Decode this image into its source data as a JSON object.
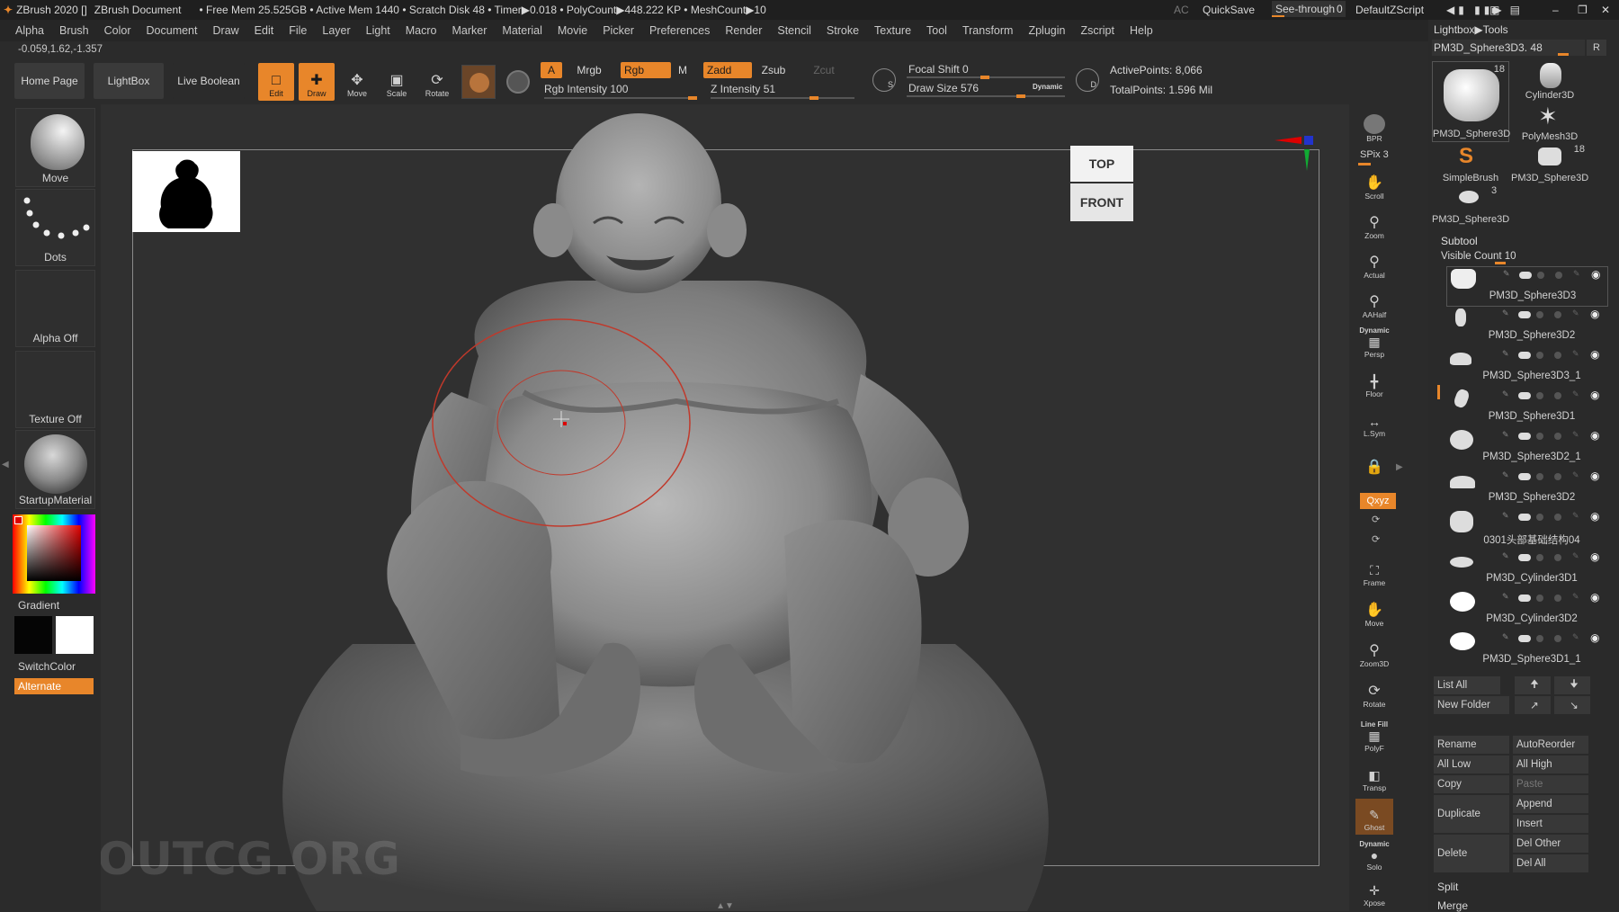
{
  "titlebar": {
    "app": "ZBrush 2020 []",
    "document": "ZBrush Document",
    "stats": "• Free Mem 25.525GB • Active Mem 1440 • Scratch Disk 48 • Timer▶0.018 • PolyCount▶448.222 KP • MeshCount▶10",
    "ac": "AC",
    "quicksave": "QuickSave",
    "see_through": "See-through",
    "see_through_value": "0",
    "default_zscript": "DefaultZScript"
  },
  "menu": [
    "Alpha",
    "Brush",
    "Color",
    "Document",
    "Draw",
    "Edit",
    "File",
    "Layer",
    "Light",
    "Macro",
    "Marker",
    "Material",
    "Movie",
    "Picker",
    "Preferences",
    "Render",
    "Stencil",
    "Stroke",
    "Texture",
    "Tool",
    "Transform",
    "Zplugin",
    "Zscript",
    "Help"
  ],
  "coords": "-0.059,1.62,-1.357",
  "toolbar": {
    "home": "Home Page",
    "lightbox": "LightBox",
    "live_boolean": "Live Boolean",
    "edit": "Edit",
    "draw": "Draw",
    "move": "Move",
    "scale": "Scale",
    "rotate": "Rotate",
    "a": "A",
    "mrgb": "Mrgb",
    "rgb": "Rgb",
    "m": "M",
    "zadd": "Zadd",
    "zsub": "Zsub",
    "zcut": "Zcut",
    "rgb_intensity": "Rgb Intensity 100",
    "z_intensity": "Z Intensity 51",
    "focal_shift": "Focal Shift 0",
    "draw_size": "Draw Size 576",
    "dynamic": "Dynamic",
    "active_points": "ActivePoints: 8,066",
    "total_points": "TotalPoints: 1.596 Mil",
    "s": "S",
    "d": "D"
  },
  "left": {
    "move": "Move",
    "dots": "Dots",
    "alpha_off": "Alpha Off",
    "texture_off": "Texture Off",
    "material": "StartupMaterial",
    "gradient": "Gradient",
    "switch_color": "SwitchColor",
    "alternate": "Alternate"
  },
  "viewport": {
    "top": "TOP",
    "front": "FRONT",
    "watermark": "ABOUTCG.ORG"
  },
  "right": {
    "bpr": "BPR",
    "spix": "SPix 3",
    "scroll": "Scroll",
    "zoom": "Zoom",
    "actual": "Actual",
    "aahalf": "AAHalf",
    "dynamic": "Dynamic",
    "persp": "Persp",
    "floor": "Floor",
    "lsym": "L.Sym",
    "xyz": "Qxyz",
    "frame": "Frame",
    "move": "Move",
    "zoom3d": "Zoom3D",
    "rotate": "Rotate",
    "linefill": "Line Fill",
    "polyf": "PolyF",
    "transp": "Transp",
    "ghost": "Ghost",
    "solo": "Solo",
    "xpose": "Xpose"
  },
  "tray": {
    "lightbox_tools": "Lightbox▶Tools",
    "current_tool": "PM3D_Sphere3D3. 48",
    "r": "R",
    "tools": [
      {
        "name": "PM3D_Sphere3D",
        "count": "18"
      },
      {
        "name": "Cylinder3D",
        "count": ""
      },
      {
        "name": "",
        "count": ""
      },
      {
        "name": "PolyMesh3D",
        "count": ""
      },
      {
        "name": "SimpleBrush",
        "count": ""
      },
      {
        "name": "PM3D_Sphere3D",
        "count": "18"
      },
      {
        "name": "PM3D_Sphere3D",
        "count": "3"
      }
    ],
    "subtool": "Subtool",
    "visible_count": "Visible Count 10",
    "subtools": [
      "PM3D_Sphere3D3",
      "PM3D_Sphere3D2",
      "PM3D_Sphere3D3_1",
      "PM3D_Sphere3D1",
      "PM3D_Sphere3D2_1",
      "PM3D_Sphere3D2",
      "0301头部基础结构04",
      "PM3D_Cylinder3D1",
      "PM3D_Cylinder3D2",
      "PM3D_Sphere3D1_1"
    ],
    "list_all": "List All",
    "new_folder": "New Folder",
    "rename": "Rename",
    "autoreorder": "AutoReorder",
    "all_low": "All Low",
    "all_high": "All High",
    "copy": "Copy",
    "paste": "Paste",
    "duplicate": "Duplicate",
    "append": "Append",
    "insert": "Insert",
    "delete": "Delete",
    "del_other": "Del Other",
    "del_all": "Del All",
    "split": "Split",
    "merge": "Merge"
  }
}
